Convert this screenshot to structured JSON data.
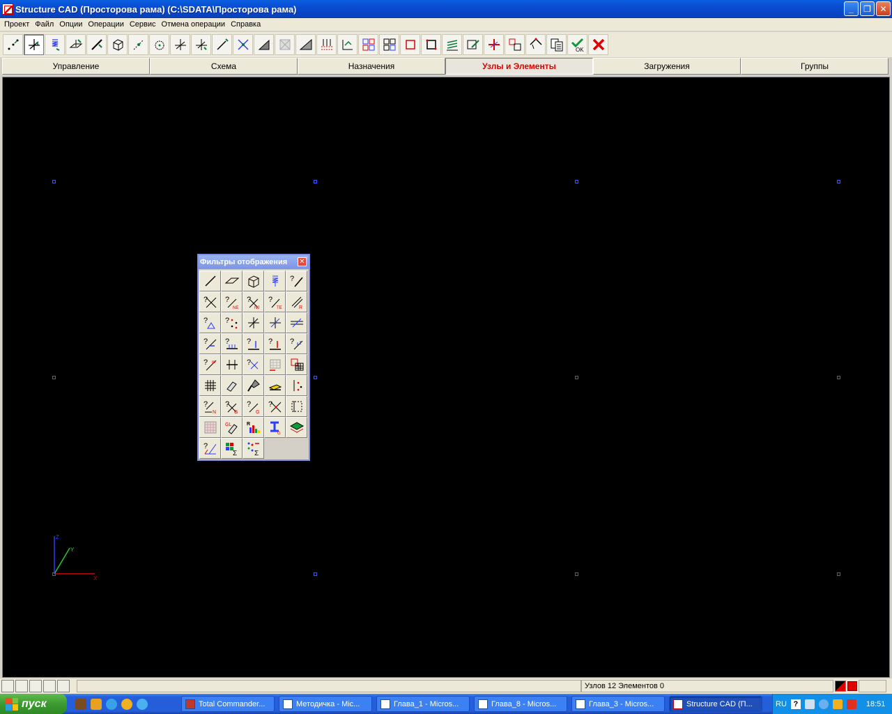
{
  "window": {
    "title": "Structure CAD (Просторова рама) (C:\\SDATA\\Просторова рама)",
    "minimize": "_",
    "restore": "❐",
    "close": "✕"
  },
  "menu": [
    "Проект",
    "Файл",
    "Опции",
    "Операции",
    "Сервис",
    "Отмена операции",
    "Справка"
  ],
  "tabs": [
    "Управление",
    "Схема",
    "Назначения",
    "Узлы и Элементы",
    "Загружения",
    "Группы"
  ],
  "active_tab": "Узлы и Элементы",
  "filter_panel": {
    "title": "Фильтры отображения",
    "close": "✕"
  },
  "axes": {
    "x": "X",
    "y": "Y",
    "z": "Z"
  },
  "status": {
    "counts": "Узлов 12 Элементов 0"
  },
  "taskbar": {
    "start": "пуск",
    "tasks": [
      "Total Commander...",
      "Методичка - Mic...",
      "Глава_1 - Micros...",
      "Глава_8 - Micros...",
      "Глава_3 - Micros...",
      "Structure CAD (П..."
    ],
    "active_task": "Structure CAD (П...",
    "lang": "RU",
    "help": "?",
    "clock": "18:51"
  },
  "colors": {
    "canvas": "#000000",
    "node": "#3a5cff",
    "active_tab_text": "#e00000",
    "axis_x": "#e00000",
    "axis_y": "#22cc22",
    "axis_z": "#2a3cff"
  }
}
